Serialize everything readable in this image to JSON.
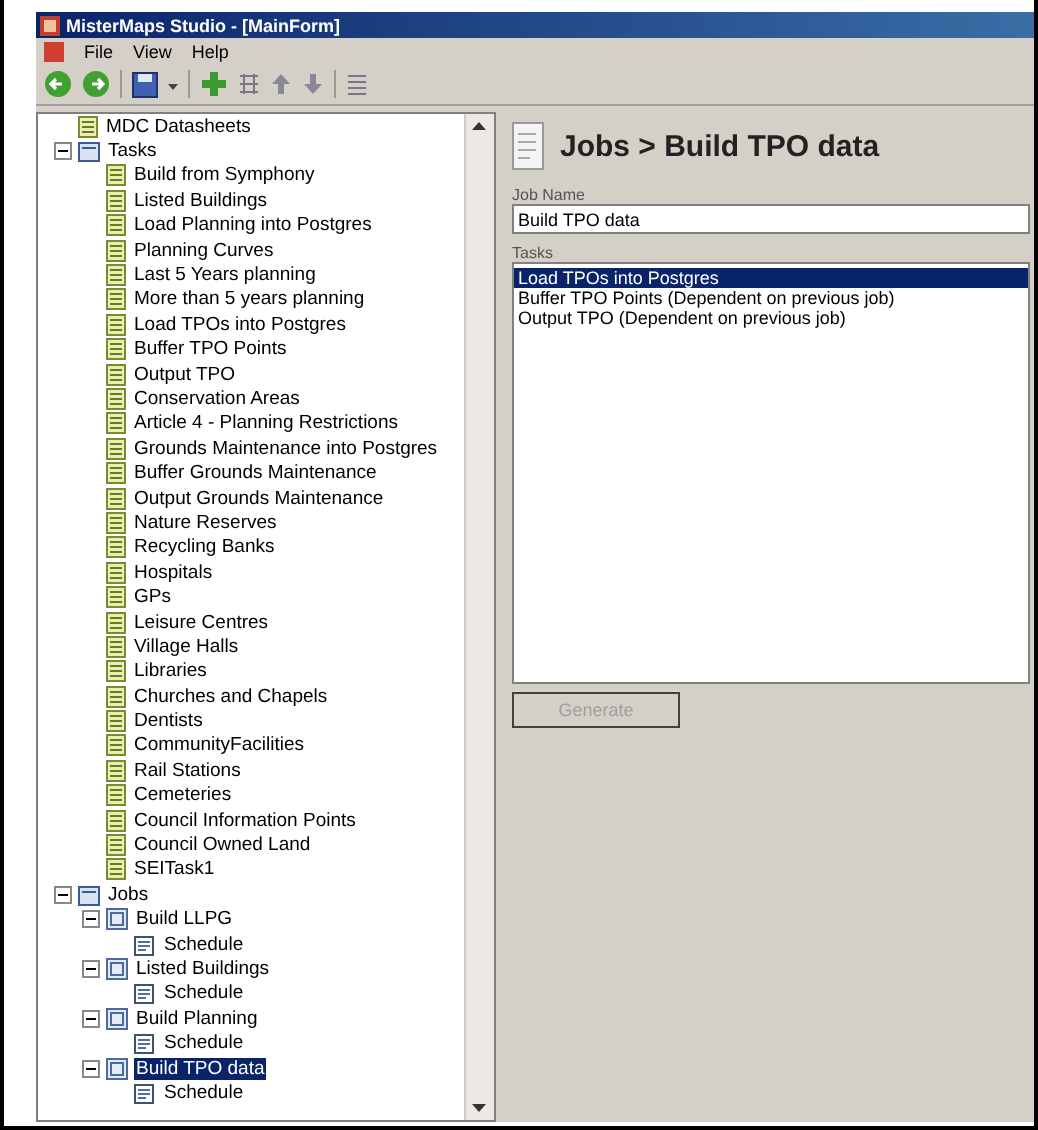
{
  "window": {
    "title": "MisterMaps Studio - [MainForm]"
  },
  "menu": [
    "File",
    "View",
    "Help"
  ],
  "tree": [
    {
      "label": "MDC Datasheets",
      "kind": "task",
      "selected": false
    },
    {
      "label": "Tasks",
      "kind": "folder",
      "expanded": true,
      "selected": false,
      "children": [
        {
          "label": "Build from Symphony",
          "kind": "task",
          "selected": false
        },
        {
          "label": "Listed Buildings",
          "kind": "task",
          "selected": false
        },
        {
          "label": "Load Planning into Postgres",
          "kind": "task",
          "selected": false
        },
        {
          "label": "Planning Curves",
          "kind": "task",
          "selected": false
        },
        {
          "label": "Last 5 Years planning",
          "kind": "task",
          "selected": false
        },
        {
          "label": "More than 5 years planning",
          "kind": "task",
          "selected": false
        },
        {
          "label": "Load TPOs into Postgres",
          "kind": "task",
          "selected": false
        },
        {
          "label": "Buffer TPO Points",
          "kind": "task",
          "selected": false
        },
        {
          "label": "Output TPO",
          "kind": "task",
          "selected": false
        },
        {
          "label": "Conservation Areas",
          "kind": "task",
          "selected": false
        },
        {
          "label": "Article 4 - Planning Restrictions",
          "kind": "task",
          "selected": false
        },
        {
          "label": "Grounds Maintenance into Postgres",
          "kind": "task",
          "selected": false
        },
        {
          "label": "Buffer Grounds Maintenance",
          "kind": "task",
          "selected": false
        },
        {
          "label": "Output Grounds Maintenance",
          "kind": "task",
          "selected": false
        },
        {
          "label": "Nature Reserves",
          "kind": "task",
          "selected": false
        },
        {
          "label": "Recycling Banks",
          "kind": "task",
          "selected": false
        },
        {
          "label": "Hospitals",
          "kind": "task",
          "selected": false
        },
        {
          "label": "GPs",
          "kind": "task",
          "selected": false
        },
        {
          "label": "Leisure Centres",
          "kind": "task",
          "selected": false
        },
        {
          "label": "Village Halls",
          "kind": "task",
          "selected": false
        },
        {
          "label": "Libraries",
          "kind": "task",
          "selected": false
        },
        {
          "label": "Churches and Chapels",
          "kind": "task",
          "selected": false
        },
        {
          "label": "Dentists",
          "kind": "task",
          "selected": false
        },
        {
          "label": "CommunityFacilities",
          "kind": "task",
          "selected": false
        },
        {
          "label": "Rail Stations",
          "kind": "task",
          "selected": false
        },
        {
          "label": "Cemeteries",
          "kind": "task",
          "selected": false
        },
        {
          "label": "Council Information Points",
          "kind": "task",
          "selected": false
        },
        {
          "label": "Council Owned Land",
          "kind": "task",
          "selected": false
        },
        {
          "label": "SEITask1",
          "kind": "task",
          "selected": false
        }
      ]
    },
    {
      "label": "Jobs",
      "kind": "folder",
      "expanded": true,
      "selected": false,
      "children": [
        {
          "label": "Build LLPG",
          "kind": "job",
          "expanded": true,
          "selected": false,
          "children": [
            {
              "label": "Schedule",
              "kind": "schedule",
              "selected": false
            }
          ]
        },
        {
          "label": "Listed Buildings",
          "kind": "job",
          "expanded": true,
          "selected": false,
          "children": [
            {
              "label": "Schedule",
              "kind": "schedule",
              "selected": false
            }
          ]
        },
        {
          "label": "Build Planning",
          "kind": "job",
          "expanded": true,
          "selected": false,
          "children": [
            {
              "label": "Schedule",
              "kind": "schedule",
              "selected": false
            }
          ]
        },
        {
          "label": "Build TPO data",
          "kind": "job",
          "expanded": true,
          "selected": true,
          "children": [
            {
              "label": "Schedule",
              "kind": "schedule",
              "selected": false
            }
          ]
        }
      ]
    }
  ],
  "detail": {
    "title": "Jobs > Build TPO data",
    "job_name_label": "Job Name",
    "job_name": "Build TPO data",
    "tasks_label": "Tasks",
    "tasks": [
      {
        "label": "Load TPOs into Postgres",
        "selected": true
      },
      {
        "label": "Buffer TPO Points (Dependent on previous job)",
        "selected": false
      },
      {
        "label": "Output TPO (Dependent on previous job)",
        "selected": false
      }
    ],
    "button": {
      "label": "Generate",
      "disabled": true
    }
  }
}
